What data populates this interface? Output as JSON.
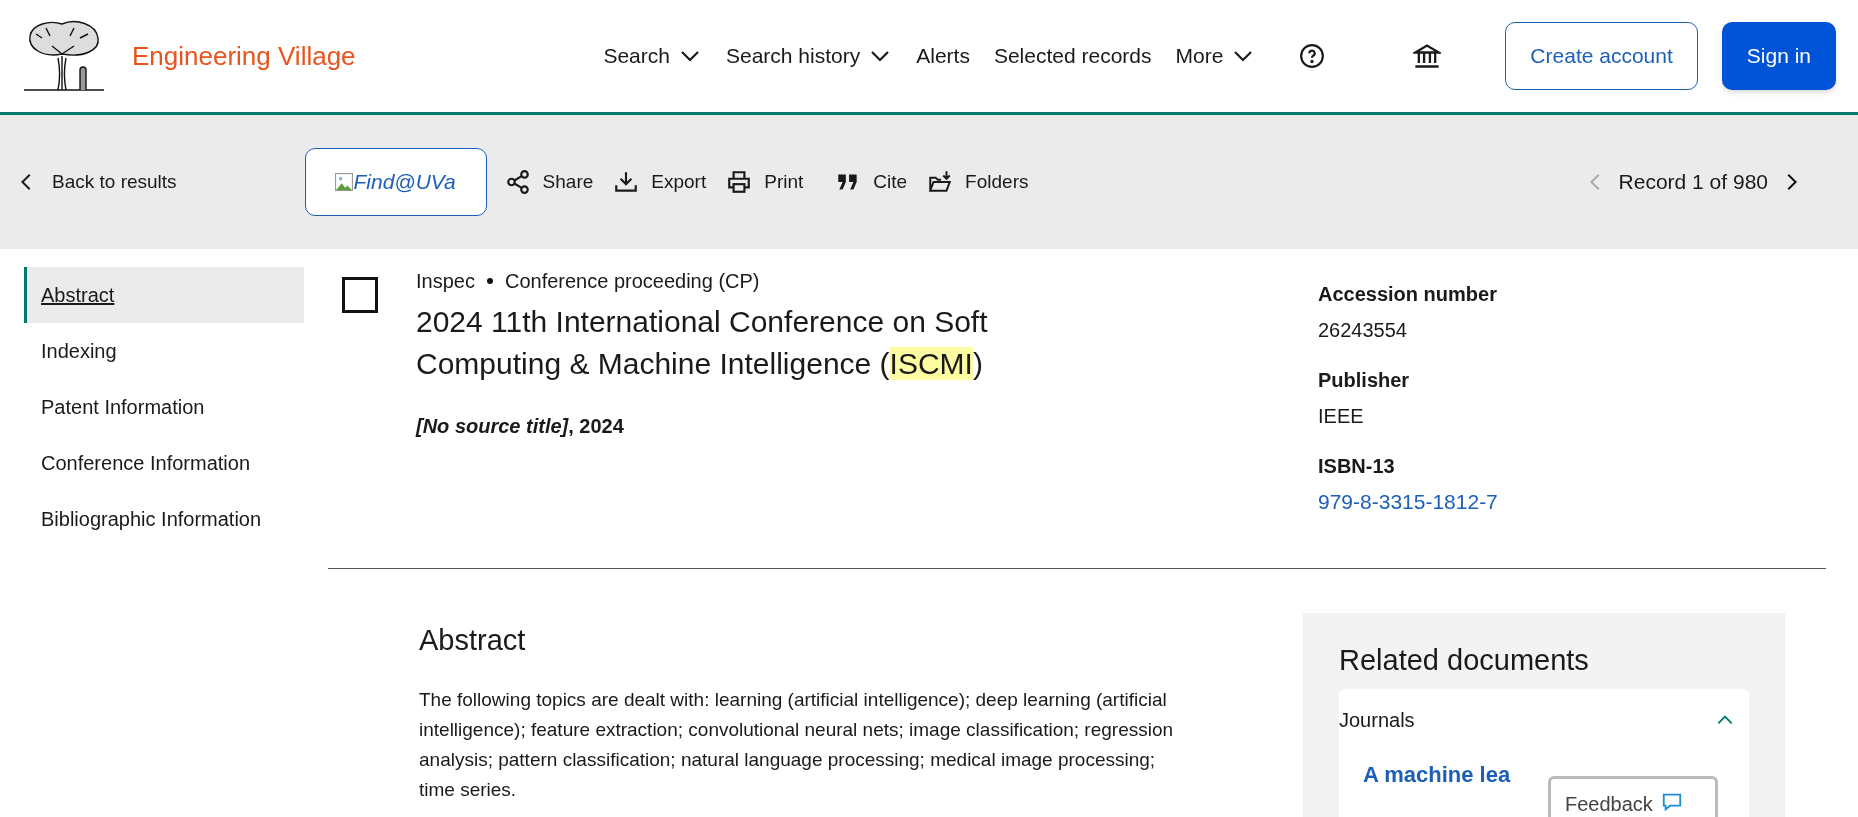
{
  "header": {
    "brand": "Engineering Village",
    "nav": [
      {
        "label": "Search",
        "dropdown": true
      },
      {
        "label": "Search history",
        "dropdown": true
      },
      {
        "label": "Alerts",
        "dropdown": false
      },
      {
        "label": "Selected records",
        "dropdown": false
      },
      {
        "label": "More",
        "dropdown": true
      }
    ],
    "create_account": "Create account",
    "sign_in": "Sign in"
  },
  "toolbar": {
    "back": "Back to results",
    "find_link": "Find@UVa",
    "actions": [
      {
        "kind": "share",
        "label": "Share"
      },
      {
        "kind": "export",
        "label": "Export"
      },
      {
        "kind": "print",
        "label": "Print"
      },
      {
        "kind": "cite",
        "label": "Cite"
      },
      {
        "kind": "folders",
        "label": "Folders"
      }
    ],
    "record": "Record 1 of 980",
    "prev_disabled": true,
    "next_disabled": false
  },
  "sidebar": {
    "items": [
      {
        "label": "Abstract",
        "selected": true
      },
      {
        "label": "Indexing",
        "selected": false
      },
      {
        "label": "Patent Information",
        "selected": false
      },
      {
        "label": "Conference Information",
        "selected": false
      },
      {
        "label": "Bibliographic Information",
        "selected": false
      }
    ]
  },
  "record": {
    "checked": false,
    "database": "Inspec",
    "doc_type": "Conference proceeding (CP)",
    "title": {
      "before": "2024 11th International Conference on Soft Computing & Machine Intelligence (",
      "highlighted": "ISCMI",
      "after": ")"
    },
    "source": "*[No source title]*, 2024",
    "details": [
      {
        "label": "Accession number",
        "value": "26243554",
        "kind": "text"
      },
      {
        "label": "Publisher",
        "value": "IEEE",
        "kind": "text"
      },
      {
        "label": "ISBN-13",
        "value": "979-8-3315-1812-7",
        "kind": "link"
      }
    ]
  },
  "abstract": {
    "heading": "Abstract",
    "text": "The following topics are dealt with: learning (artificial intelligence); deep learning (artificial intelligence); feature extraction; convolutional neural nets; image classification; regression analysis; pattern classification; natural language processing; medical image processing; time series."
  },
  "related": {
    "heading": "Related documents",
    "section": "Journals",
    "expanded": true,
    "first_link": "A machine lea"
  },
  "feedback": "Feedback"
}
